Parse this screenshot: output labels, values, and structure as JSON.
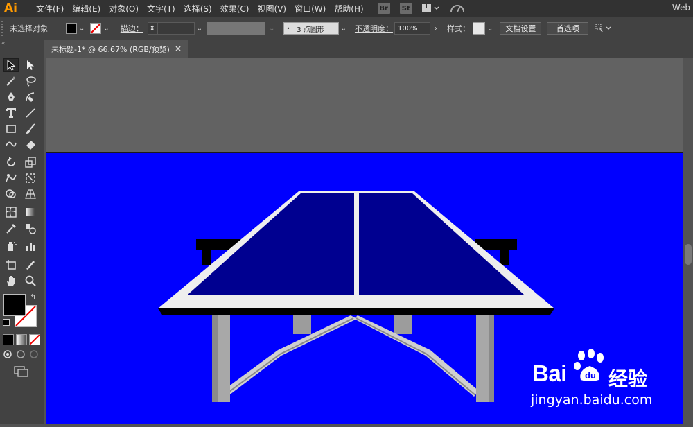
{
  "app": {
    "logo": "Ai",
    "workspace": "Web"
  },
  "menu": [
    "文件(F)",
    "编辑(E)",
    "对象(O)",
    "文字(T)",
    "选择(S)",
    "效果(C)",
    "视图(V)",
    "窗口(W)",
    "帮助(H)"
  ],
  "bridge_badges": [
    "Br",
    "St"
  ],
  "control_bar": {
    "selection_status": "未选择对象",
    "stroke_label": "描边：",
    "brush_value": "3 点圆形",
    "opacity_label": "不透明度：",
    "opacity_value": "100%",
    "style_label": "样式：",
    "doc_setup_button": "文档设置",
    "preferences_button": "首选项"
  },
  "document_tab": {
    "title": "未标题-1* @ 66.67% (RGB/预览)",
    "close": "×"
  },
  "colors": {
    "artboard": "#0000ff",
    "table_top": "#000090",
    "table_frame": "#eeeeee",
    "app_accent": "#ff9a00"
  },
  "watermark": {
    "brand": "Bai",
    "brand_suffix": "经验",
    "url": "jingyan.baidu.com"
  }
}
